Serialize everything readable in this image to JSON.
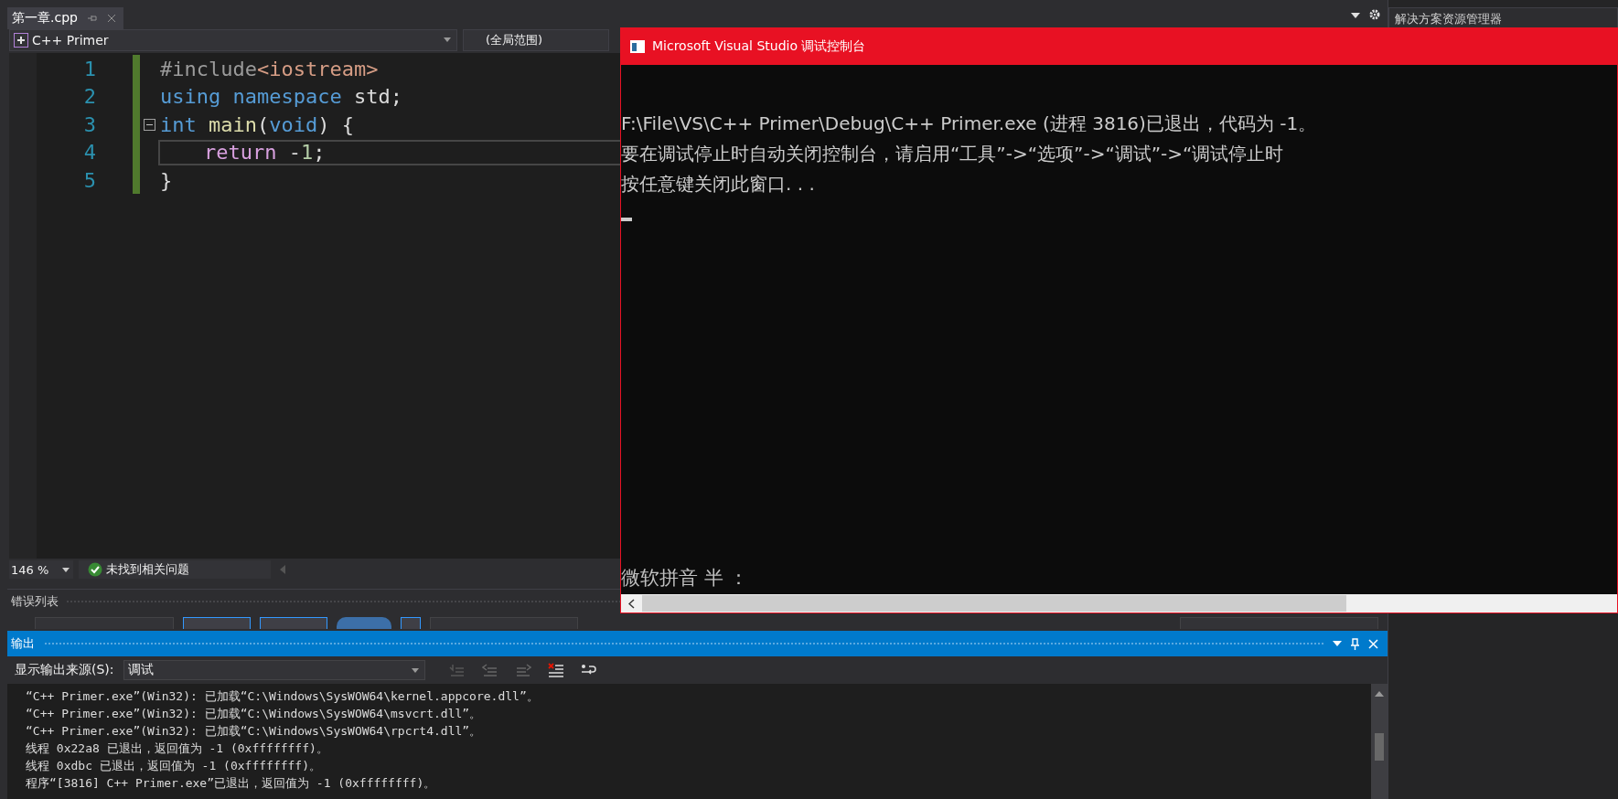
{
  "editor_tabs": [
    {
      "label": "第一章.cpp",
      "selected": true
    }
  ],
  "solution_explorer": {
    "title": "解决方案资源管理器"
  },
  "navigation": {
    "project": "C++ Primer",
    "scope": "(全局范围)"
  },
  "code_lines": [
    {
      "number": "1",
      "indented": false,
      "collapsible": false,
      "current": false,
      "tokens": [
        {
          "text": "#include",
          "kind": "preprocessor"
        },
        {
          "text": "<iostream>",
          "kind": "string"
        }
      ]
    },
    {
      "number": "2",
      "indented": false,
      "collapsible": false,
      "current": false,
      "tokens": [
        {
          "text": "using namespace",
          "kind": "keyword"
        },
        {
          "text": " std;",
          "kind": "plain"
        }
      ]
    },
    {
      "number": "3",
      "indented": false,
      "collapsible": true,
      "current": false,
      "tokens": [
        {
          "text": "int",
          "kind": "keyword"
        },
        {
          "text": " main",
          "kind": "function"
        },
        {
          "text": "(",
          "kind": "plain"
        },
        {
          "text": "void",
          "kind": "keyword"
        },
        {
          "text": ") {",
          "kind": "plain"
        }
      ]
    },
    {
      "number": "4",
      "indented": true,
      "collapsible": false,
      "current": true,
      "tokens": [
        {
          "text": "return",
          "kind": "control"
        },
        {
          "text": " -",
          "kind": "plain"
        },
        {
          "text": "1",
          "kind": "number"
        },
        {
          "text": ";",
          "kind": "plain"
        }
      ]
    },
    {
      "number": "5",
      "indented": false,
      "collapsible": false,
      "current": false,
      "tokens": [
        {
          "text": "}",
          "kind": "plain"
        }
      ]
    }
  ],
  "status": {
    "zoom": "146 %",
    "issues": "未找到相关问题"
  },
  "error_list": {
    "title": "错误列表"
  },
  "output": {
    "title": "输出",
    "source_label": "显示输出来源(S):",
    "source": "调试",
    "lines": [
      "“C++ Primer.exe”(Win32): 已加载“C:\\Windows\\SysWOW64\\kernel.appcore.dll”。",
      "“C++ Primer.exe”(Win32): 已加载“C:\\Windows\\SysWOW64\\msvcrt.dll”。",
      "“C++ Primer.exe”(Win32): 已加载“C:\\Windows\\SysWOW64\\rpcrt4.dll”。",
      "线程 0x22a8 已退出，返回值为 -1 (0xffffffff)。",
      "线程 0xdbc 已退出，返回值为 -1 (0xffffffff)。",
      "程序“[3816] C++ Primer.exe”已退出，返回值为 -1 (0xffffffff)。"
    ]
  },
  "console": {
    "title": "Microsoft Visual Studio 调试控制台",
    "lines": [
      "F:\\File\\VS\\C++ Primer\\Debug\\C++ Primer.exe (进程 3816)已退出，代码为 -1。",
      "要在调试停止时自动关闭控制台，请启用“工具”->“选项”->“调试”->“调试停止时",
      "按任意键关闭此窗口. . ."
    ],
    "ime_status": "微软拼音 半 ："
  }
}
